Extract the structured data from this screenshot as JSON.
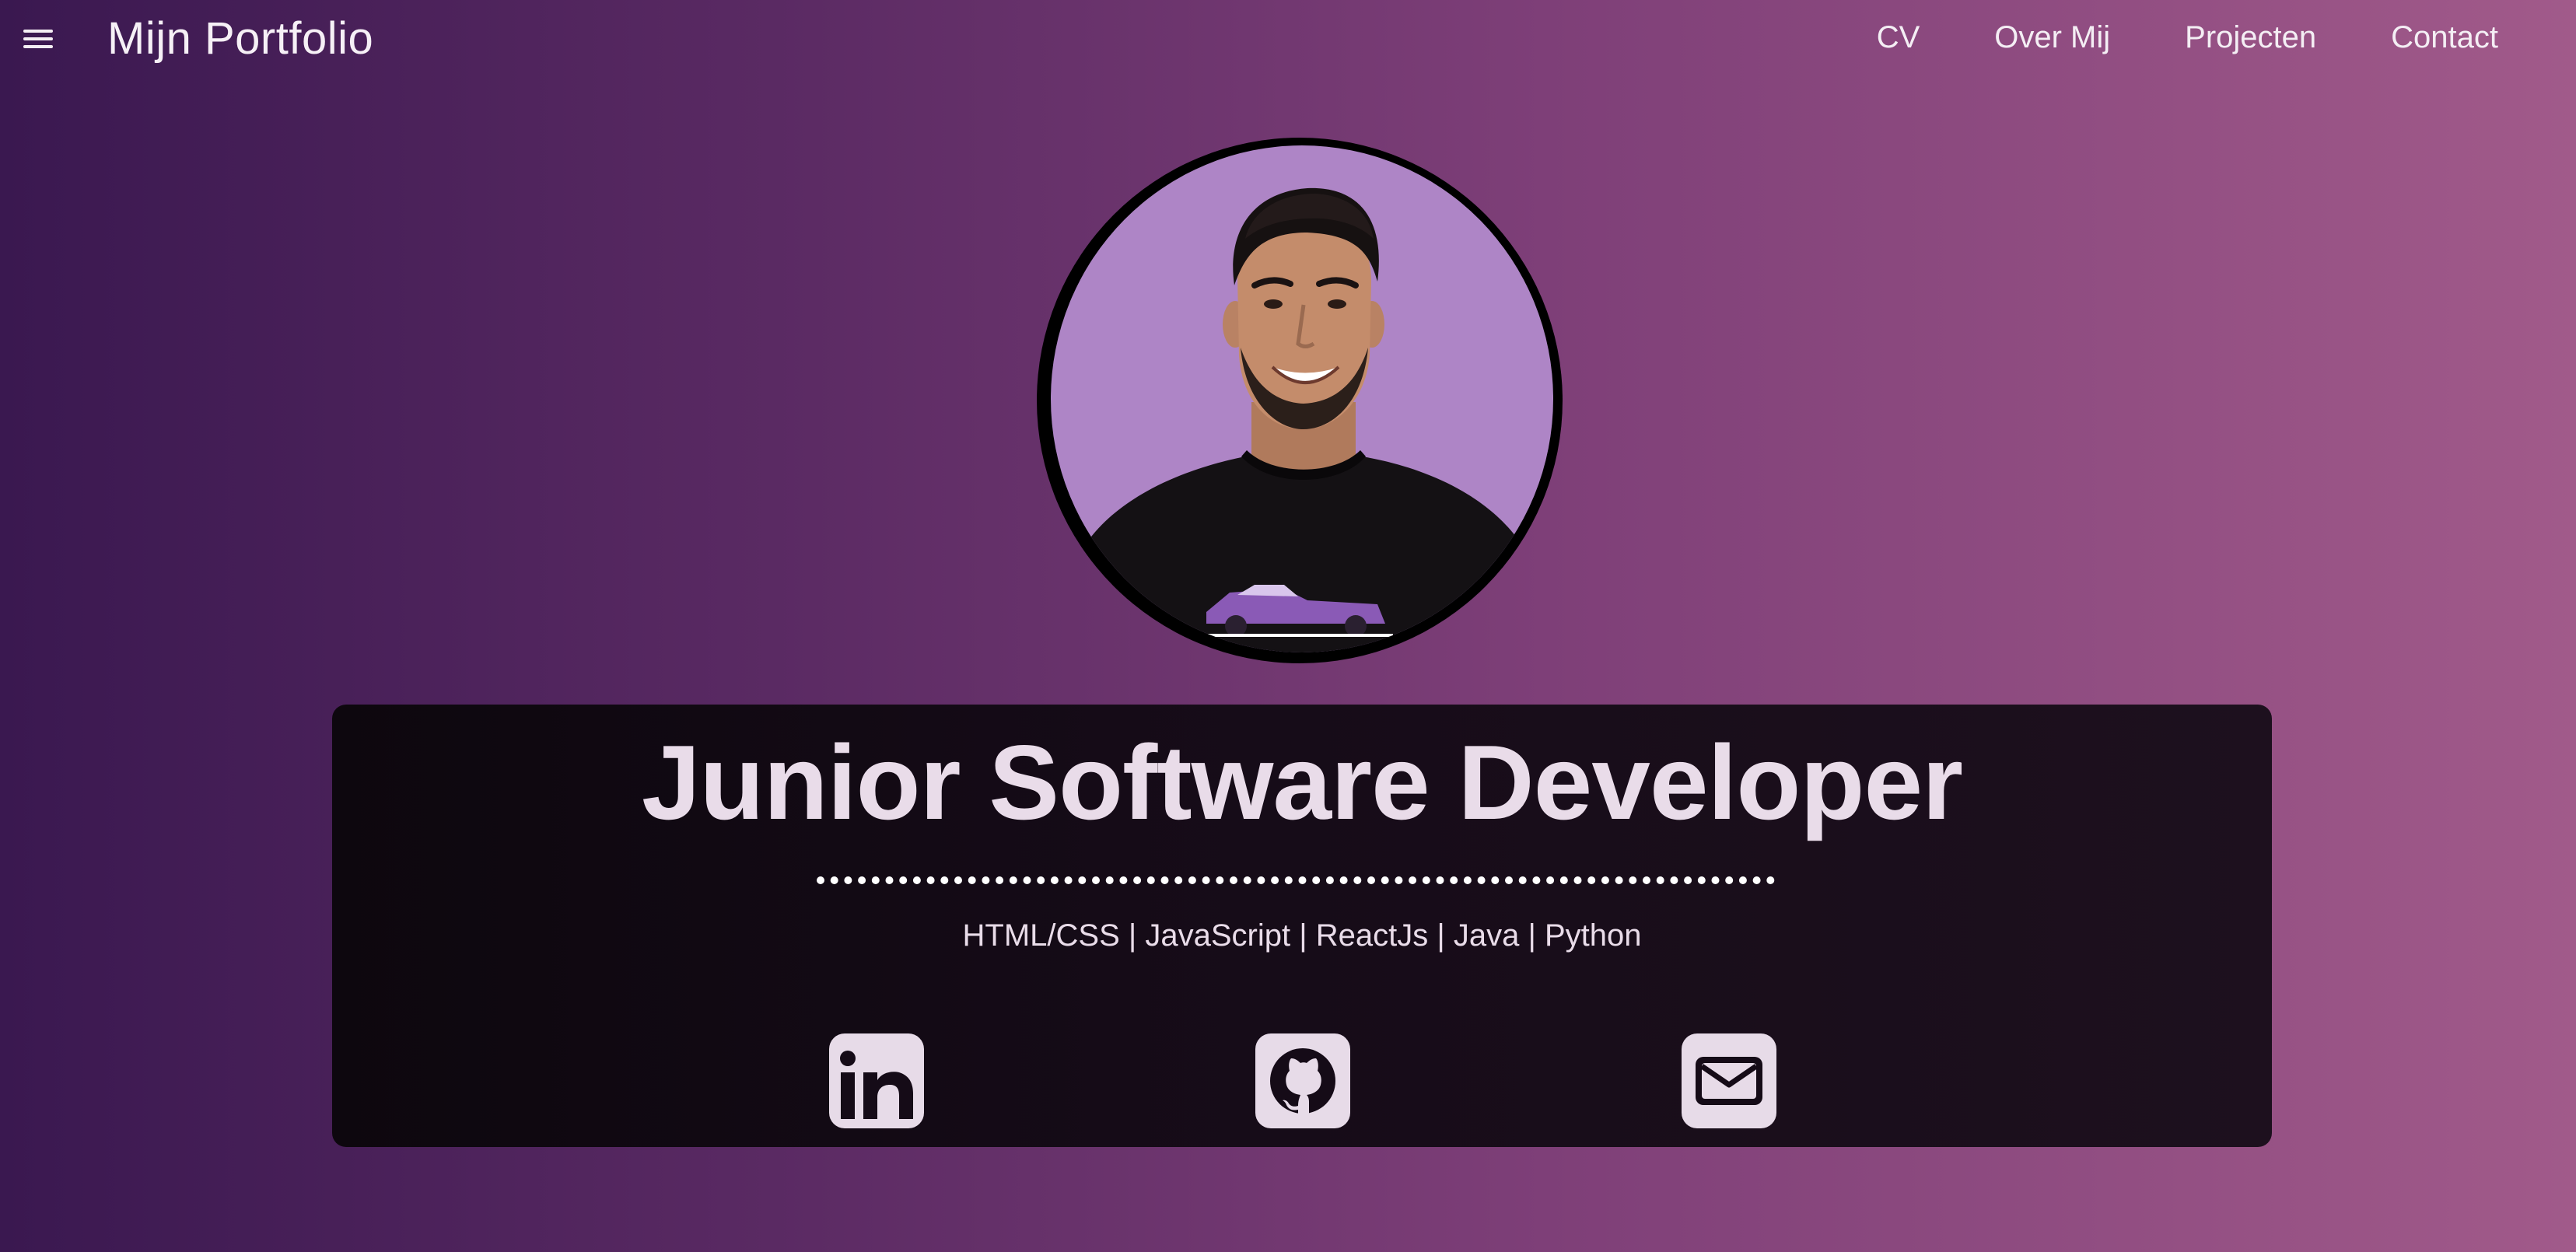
{
  "header": {
    "menu_icon": "hamburger-menu-icon",
    "brand": "Mijn Portfolio",
    "nav": [
      {
        "label": "CV"
      },
      {
        "label": "Over Mij"
      },
      {
        "label": "Projecten"
      },
      {
        "label": "Contact"
      }
    ]
  },
  "hero": {
    "title": "Junior Software Developer",
    "skills": "HTML/CSS | JavaScript | ReactJs | Java | Python",
    "social": [
      {
        "icon": "linkedin-icon"
      },
      {
        "icon": "github-icon"
      },
      {
        "icon": "mail-icon"
      }
    ]
  },
  "colors": {
    "background_start": "#3a1850",
    "background_end": "#a15a8a",
    "avatar_bg": "#ae85c6",
    "card_bg": "#140a15",
    "text_light": "#e9dce9"
  }
}
